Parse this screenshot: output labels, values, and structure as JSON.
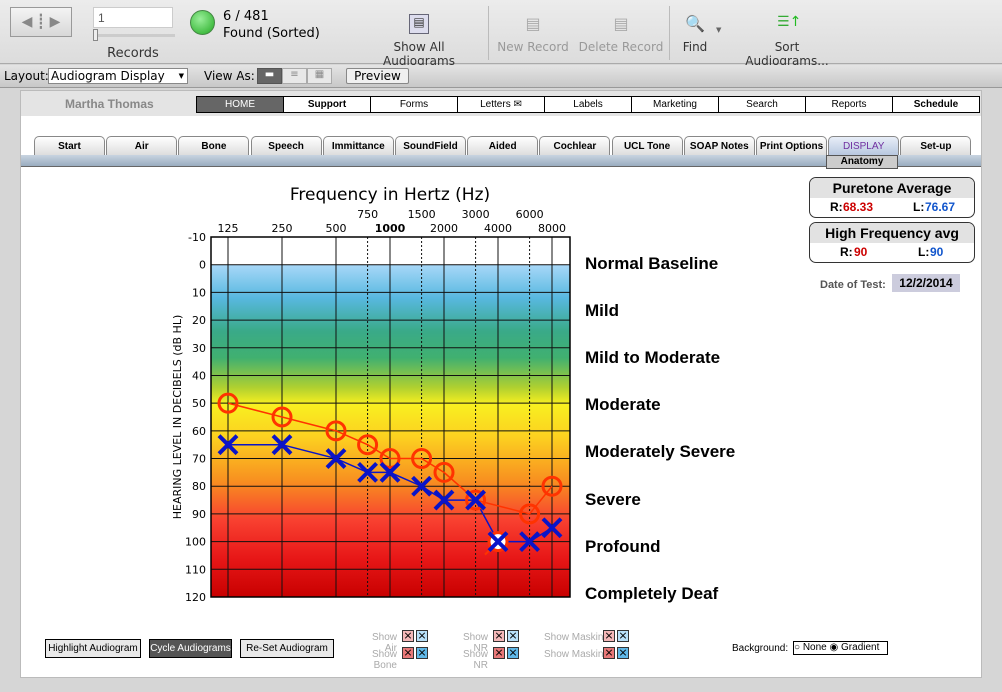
{
  "toolbar": {
    "record_number": "1",
    "records_label": "Records",
    "found_count": "6 / 481",
    "found_status": "Found (Sorted)",
    "show_all": "Show All Audiograms",
    "new_record": "New Record",
    "delete_record": "Delete Record",
    "find": "Find",
    "sort": "Sort Audiograms..."
  },
  "layoutbar": {
    "layout_label": "Layout:",
    "layout_value": "Audiogram Display",
    "view_as_label": "View As:",
    "preview": "Preview"
  },
  "patient": {
    "name": "Martha Thomas"
  },
  "nav": [
    "HOME",
    "Support",
    "Forms",
    "Letters",
    "Labels",
    "Marketing",
    "Search",
    "Reports",
    "Schedule"
  ],
  "tabs": [
    "Start",
    "Air",
    "Bone",
    "Speech",
    "Immittance",
    "SoundField",
    "Aided",
    "Cochlear",
    "UCL Tone",
    "SOAP Notes",
    "Print Options",
    "DISPLAY",
    "Set-up"
  ],
  "subtab": "Anatomy",
  "puretone": {
    "title": "Puretone Average",
    "r_label": "R:",
    "r": "68.33",
    "l_label": "L:",
    "l": "76.67"
  },
  "highfreq": {
    "title": "High Frequency avg",
    "r_label": "R:",
    "r": "90",
    "l_label": "L:",
    "l": "90"
  },
  "date": {
    "label": "Date of Test:",
    "value": "12/2/2014"
  },
  "categories": [
    "Normal Baseline",
    "Mild",
    "Mild to Moderate",
    "Moderate",
    "Moderately Severe",
    "Severe",
    "Profound",
    "Completely Deaf"
  ],
  "buttons": {
    "highlight": "Highlight Audiogram",
    "cycle": "Cycle Audiograms",
    "reset": "Re-Set Audiogram"
  },
  "toggles": {
    "air": "Show Air",
    "bone": "Show Bone",
    "nr1": "Show NR",
    "nr2": "Show NR",
    "mask1": "Show Masking",
    "mask2": "Show Masking"
  },
  "background": {
    "label": "Background:",
    "none": "None",
    "gradient": "Gradient",
    "selected": "Gradient"
  },
  "chart_data": {
    "type": "line",
    "title": "Frequency in Hertz (Hz)",
    "ylabel": "HEARING LEVEL IN DECIBELS (dB HL)",
    "x_ticks_main": [
      "125",
      "250",
      "500",
      "1000",
      "2000",
      "4000",
      "8000"
    ],
    "x_ticks_inter": [
      "750",
      "1500",
      "3000",
      "6000"
    ],
    "x_scale": "log",
    "y_ticks": [
      "-10",
      "0",
      "10",
      "20",
      "30",
      "40",
      "50",
      "60",
      "70",
      "80",
      "90",
      "100",
      "110",
      "120"
    ],
    "ylim": [
      -10,
      120
    ],
    "y_inverted": true,
    "series": [
      {
        "ear": "right",
        "symbol": "O",
        "color": "#ff3300",
        "x": [
          125,
          250,
          500,
          750,
          1000,
          1500,
          2000,
          3000,
          6000,
          8000
        ],
        "y": [
          50,
          55,
          60,
          65,
          70,
          70,
          75,
          85,
          90,
          80
        ]
      },
      {
        "ear": "left",
        "symbol": "X",
        "color": "#0a14c8",
        "x": [
          125,
          250,
          500,
          750,
          1000,
          1500,
          2000,
          3000,
          4000,
          6000,
          8000
        ],
        "y": [
          65,
          65,
          70,
          75,
          75,
          80,
          85,
          85,
          100,
          100,
          95
        ]
      }
    ],
    "no_response": [
      {
        "ear": "right",
        "x": 4000,
        "y": 100
      }
    ]
  }
}
